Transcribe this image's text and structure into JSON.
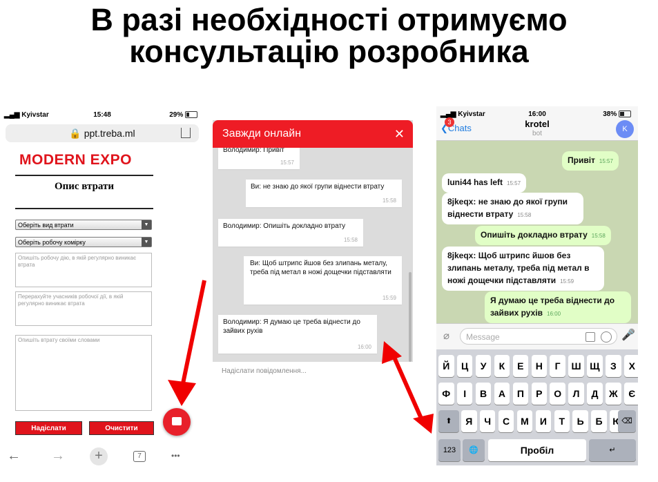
{
  "title": {
    "line1": "В разі необхідності отримуємо",
    "line2": "консультацію розробника"
  },
  "phone1": {
    "carrier": "Kyivstar",
    "time": "15:48",
    "battery": "29%",
    "url": "ppt.treba.ml",
    "logo": "MODERN EXPO",
    "heading": "Опис втрати",
    "select1": "Оберіть вид втрати",
    "select2": "Оберіть робочу комірку",
    "textarea1": "Опишіть робочу дію, в якій регулярно виникає втрата",
    "textarea2": "Перерахуйте учасників робочої дії, в якій регулярно виникає втрата",
    "textarea3": "Опишіть втрату своїми словами",
    "submit_label": "Надіслати",
    "clear_label": "Очистити",
    "tabs_count": "7",
    "toolbar": {
      "back": "←",
      "forward": "→",
      "plus": "+",
      "more": "•••"
    }
  },
  "chat_widget": {
    "header": "Завжди онлайн",
    "close": "✕",
    "messages": [
      {
        "text": "Володимир: Привіт",
        "time": "15:57"
      },
      {
        "text": "Ви: не знаю до якої групи віднести втрату",
        "time": "15:58"
      },
      {
        "text": "Володимир: Опишіть докладно втрату",
        "time": "15:58"
      },
      {
        "text": "Ви: Щоб штрипс йшов без злипань металу, треба під метал в ножі дощечки підставляти",
        "time": "15:59"
      },
      {
        "text": "Володимир: Я думаю це треба віднести до зайвих рухів",
        "time": "16:00"
      }
    ],
    "input_placeholder": "Надіслати повідомлення..."
  },
  "telegram": {
    "carrier": "Kyivstar",
    "time": "16:00",
    "battery": "38%",
    "back_label": "Chats",
    "unread_badge": "3",
    "chat_name": "krotel",
    "chat_status": "bot",
    "avatar_letter": "K",
    "messages": [
      {
        "text": "Привіт",
        "time": "15:57",
        "dir": "out"
      },
      {
        "text": "luni44 has left",
        "time": "15:57",
        "dir": "in"
      },
      {
        "text": "8jkeqx: не знаю до якої групи віднести втрату",
        "time": "15:58",
        "dir": "in"
      },
      {
        "text": "Опишіть докладно втрату",
        "time": "15:58",
        "dir": "out"
      },
      {
        "text": "8jkeqx: Щоб штрипс йшов без злипань металу, треба під метал в ножі дощечки підставляти",
        "time": "15:59",
        "dir": "in"
      },
      {
        "text": "Я думаю це треба віднести до зайвих рухів",
        "time": "16:00",
        "dir": "out"
      }
    ],
    "input_placeholder": "Message",
    "keyboard": {
      "row1": [
        "Й",
        "Ц",
        "У",
        "К",
        "Е",
        "Н",
        "Г",
        "Ш",
        "Щ",
        "З",
        "Х"
      ],
      "row2": [
        "Ф",
        "І",
        "В",
        "А",
        "П",
        "Р",
        "О",
        "Л",
        "Д",
        "Ж",
        "Є"
      ],
      "row3": [
        "Я",
        "Ч",
        "С",
        "М",
        "И",
        "Т",
        "Ь",
        "Б",
        "Ю"
      ],
      "numbers": "123",
      "space": "Пробіл",
      "return": "↵",
      "shift": "⬆",
      "delete": "⌫",
      "globe": "🌐"
    }
  },
  "colors": {
    "accent_red": "#ee1c25",
    "telegram_out": "#e1fec6",
    "telegram_link": "#1f7ce0"
  }
}
